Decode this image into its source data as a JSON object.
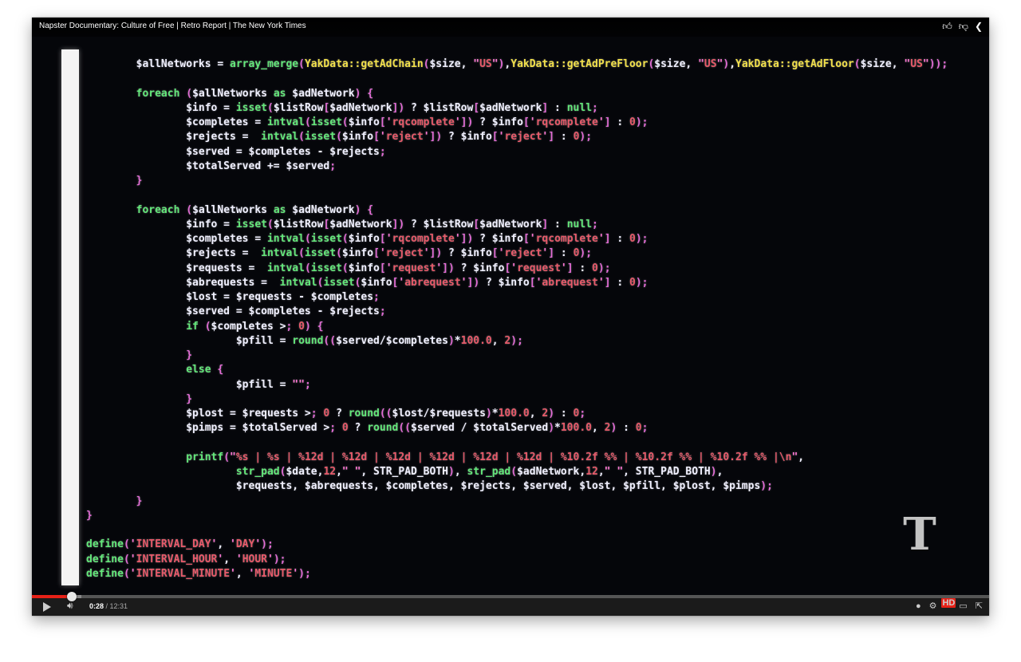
{
  "window": {
    "title": "Napster Documentary: Culture of Free | Retro Report | The New York Times",
    "top_icons": [
      "thumbs-up-icon",
      "thumbs-down-icon",
      "share-icon"
    ]
  },
  "video": {
    "logo_text": "T",
    "code_lines": [
      "        $allNetworks = array_merge(YakData::getAdChain($size, \"US\"),YakData::getAdPreFloor($size, \"US\"),YakData::getAdFloor($size, \"US\"));",
      "",
      "        foreach ($allNetworks as $adNetwork) {",
      "                $info = isset($listRow[$adNetwork]) ? $listRow[$adNetwork] : null;",
      "                $completes = intval(isset($info['rqcomplete']) ? $info['rqcomplete'] : 0);",
      "                $rejects =  intval(isset($info['reject']) ? $info['reject'] : 0);",
      "                $served = $completes - $rejects;",
      "                $totalServed += $served;",
      "        }",
      "",
      "        foreach ($allNetworks as $adNetwork) {",
      "                $info = isset($listRow[$adNetwork]) ? $listRow[$adNetwork] : null;",
      "                $completes = intval(isset($info['rqcomplete']) ? $info['rqcomplete'] : 0);",
      "                $rejects =  intval(isset($info['reject']) ? $info['reject'] : 0);",
      "                $requests =  intval(isset($info['request']) ? $info['request'] : 0);",
      "                $abrequests =  intval(isset($info['abrequest']) ? $info['abrequest'] : 0);",
      "                $lost = $requests - $completes;",
      "                $served = $completes - $rejects;",
      "                if ($completes > 0) {",
      "                        $pfill = round(($served/$completes)*100.0, 2);",
      "                }",
      "                else {",
      "                        $pfill = \"\";",
      "                }",
      "                $plost = $requests > 0 ? round(($lost/$requests)*100.0, 2) : 0;",
      "                $pimps = $totalServed > 0 ? round(($served / $totalServed)*100.0, 2) : 0;",
      "",
      "                printf(\"%s | %s | %12d | %12d | %12d | %12d | %12d | %12d | %10.2f %% | %10.2f %% | %10.2f %% |\\n\",",
      "                        str_pad($date,12,\" \", STR_PAD_BOTH), str_pad($adNetwork,12,\" \", STR_PAD_BOTH),",
      "                        $requests, $abrequests, $completes, $rejects, $served, $lost, $pfill, $plost, $pimps);",
      "        }",
      "}",
      "",
      "define('INTERVAL_DAY', 'DAY');",
      "define('INTERVAL_HOUR', 'HOUR');",
      "define('INTERVAL_MINUTE', 'MINUTE');"
    ]
  },
  "controls": {
    "current_time": "0:28",
    "separator": " / ",
    "duration": "12:31",
    "progress_played": 0.042,
    "progress_buffered": 0.052,
    "hd_badge": "HD",
    "icons": [
      "play-icon",
      "volume-icon",
      "info-icon",
      "settings-icon",
      "theater-icon",
      "fullscreen-icon"
    ]
  },
  "colors": {
    "progress_red": "#e62117",
    "code_green": "#63e87a",
    "code_magenta": "#e36bd6",
    "code_yellow": "#f2e04a",
    "code_red": "#e85a6a"
  }
}
